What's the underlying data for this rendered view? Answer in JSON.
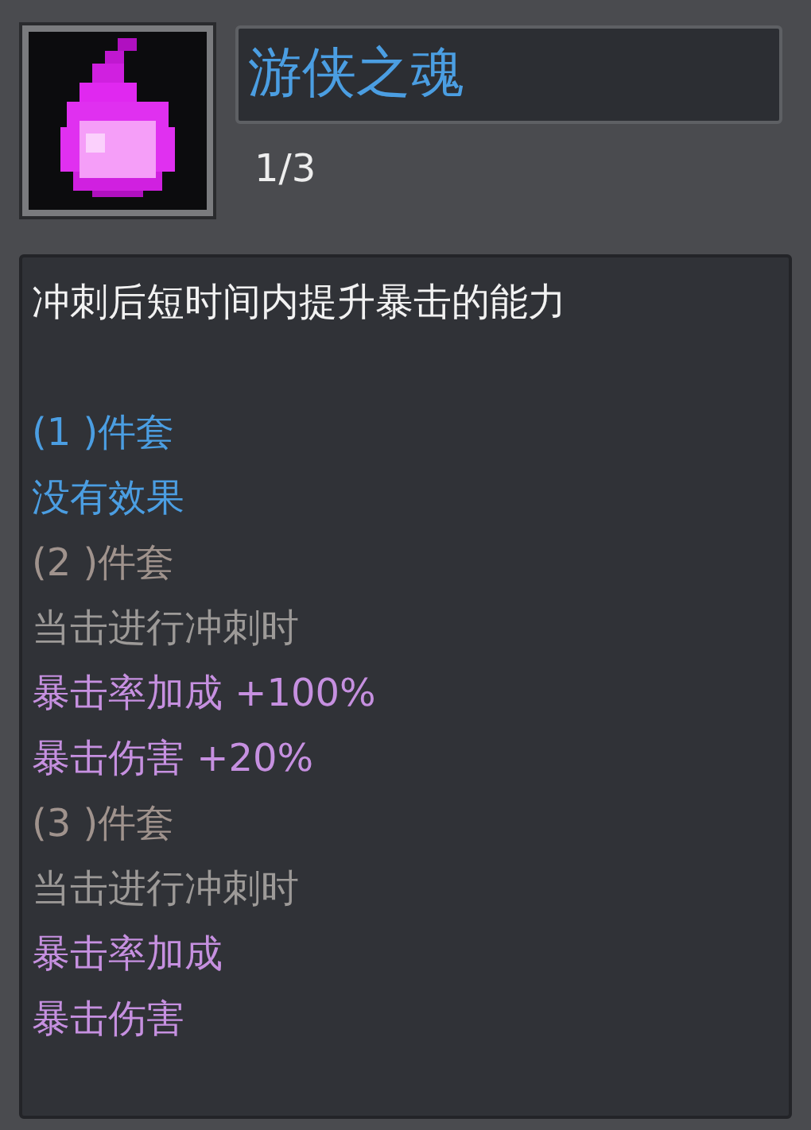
{
  "item": {
    "name": "游侠之魂",
    "count": "1/3"
  },
  "description": "冲刺后短时间内提升暴击的能力",
  "tiers": [
    {
      "label": "(1 )件套",
      "active": true,
      "lines": [
        {
          "kind": "note",
          "text": "没有效果"
        }
      ]
    },
    {
      "label": "(2 )件套",
      "active": false,
      "lines": [
        {
          "kind": "condition",
          "text": "当击进行冲刺时"
        },
        {
          "kind": "bonus",
          "text": "暴击率加成 +100%"
        },
        {
          "kind": "bonus",
          "text": "暴击伤害 +20%"
        }
      ]
    },
    {
      "label": "(3 )件套",
      "active": false,
      "lines": [
        {
          "kind": "condition",
          "text": "当击进行冲刺时"
        },
        {
          "kind": "bonus",
          "text": "暴击率加成"
        },
        {
          "kind": "bonus",
          "text": "暴击伤害"
        }
      ]
    }
  ]
}
